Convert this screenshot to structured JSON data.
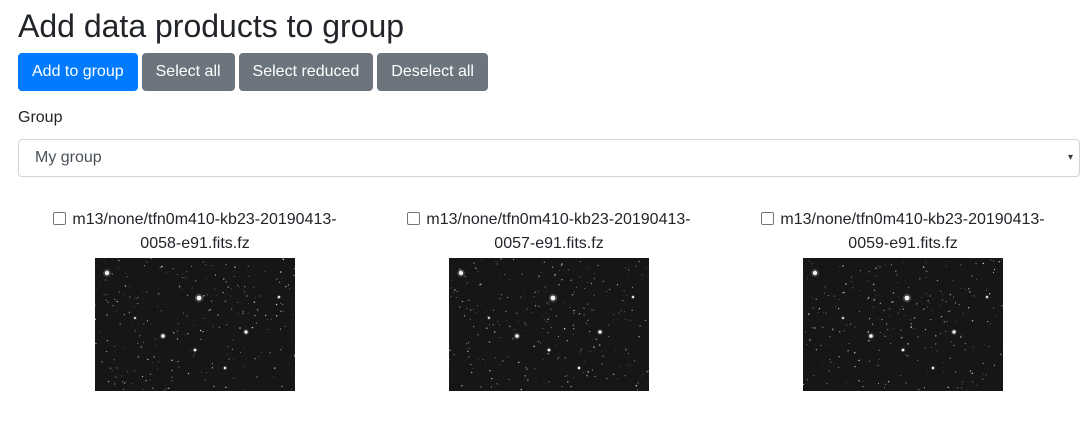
{
  "page": {
    "title": "Add data products to group"
  },
  "toolbar": {
    "add_label": "Add to group",
    "select_all_label": "Select all",
    "select_reduced_label": "Select reduced",
    "deselect_all_label": "Deselect all"
  },
  "group": {
    "label": "Group",
    "selected": "My group"
  },
  "products": [
    {
      "name_line1": "m13/none/tfn0m410-kb23-20190413-",
      "name_line2": "0058-e91.fits.fz",
      "checked": false
    },
    {
      "name_line1": "m13/none/tfn0m410-kb23-20190413-",
      "name_line2": "0057-e91.fits.fz",
      "checked": false
    },
    {
      "name_line1": "m13/none/tfn0m410-kb23-20190413-",
      "name_line2": "0059-e91.fits.fz",
      "checked": false
    }
  ],
  "colors": {
    "primary": "#007bff",
    "secondary": "#6c757d",
    "thumbnail_bg": "#161616"
  },
  "icons": {
    "select_caret": "chevron-down-icon"
  }
}
